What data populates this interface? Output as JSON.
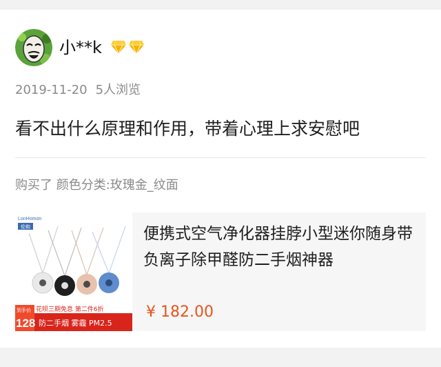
{
  "user": {
    "name": "小**k",
    "avatar_icon": "masked-face-avatar",
    "badge_icon": "diamond-icon",
    "badge_count": 2
  },
  "meta": {
    "date": "2019-11-20",
    "views": "5人浏览"
  },
  "review": {
    "text": "看不出什么原理和作用，带着心理上求安慰吧"
  },
  "purchase": {
    "text": "购买了 颜色分类:玫瑰金_纹面"
  },
  "product": {
    "title": "便携式空气净化器挂脖小型迷你随身带负离子除甲醛防二手烟神器",
    "price": "¥ 182.00",
    "thumbnail": {
      "brand": "LonHomon",
      "brand_sub": "伦和",
      "promo_line": "花呗三期免息 第二件6折",
      "price_label": "到手价",
      "price_value": "128",
      "features": "防二手烟 雾霾 PM2.5"
    }
  },
  "colors": {
    "price": "#e8541b",
    "badge": "#f5b400",
    "promo_red": "#d9241b"
  }
}
